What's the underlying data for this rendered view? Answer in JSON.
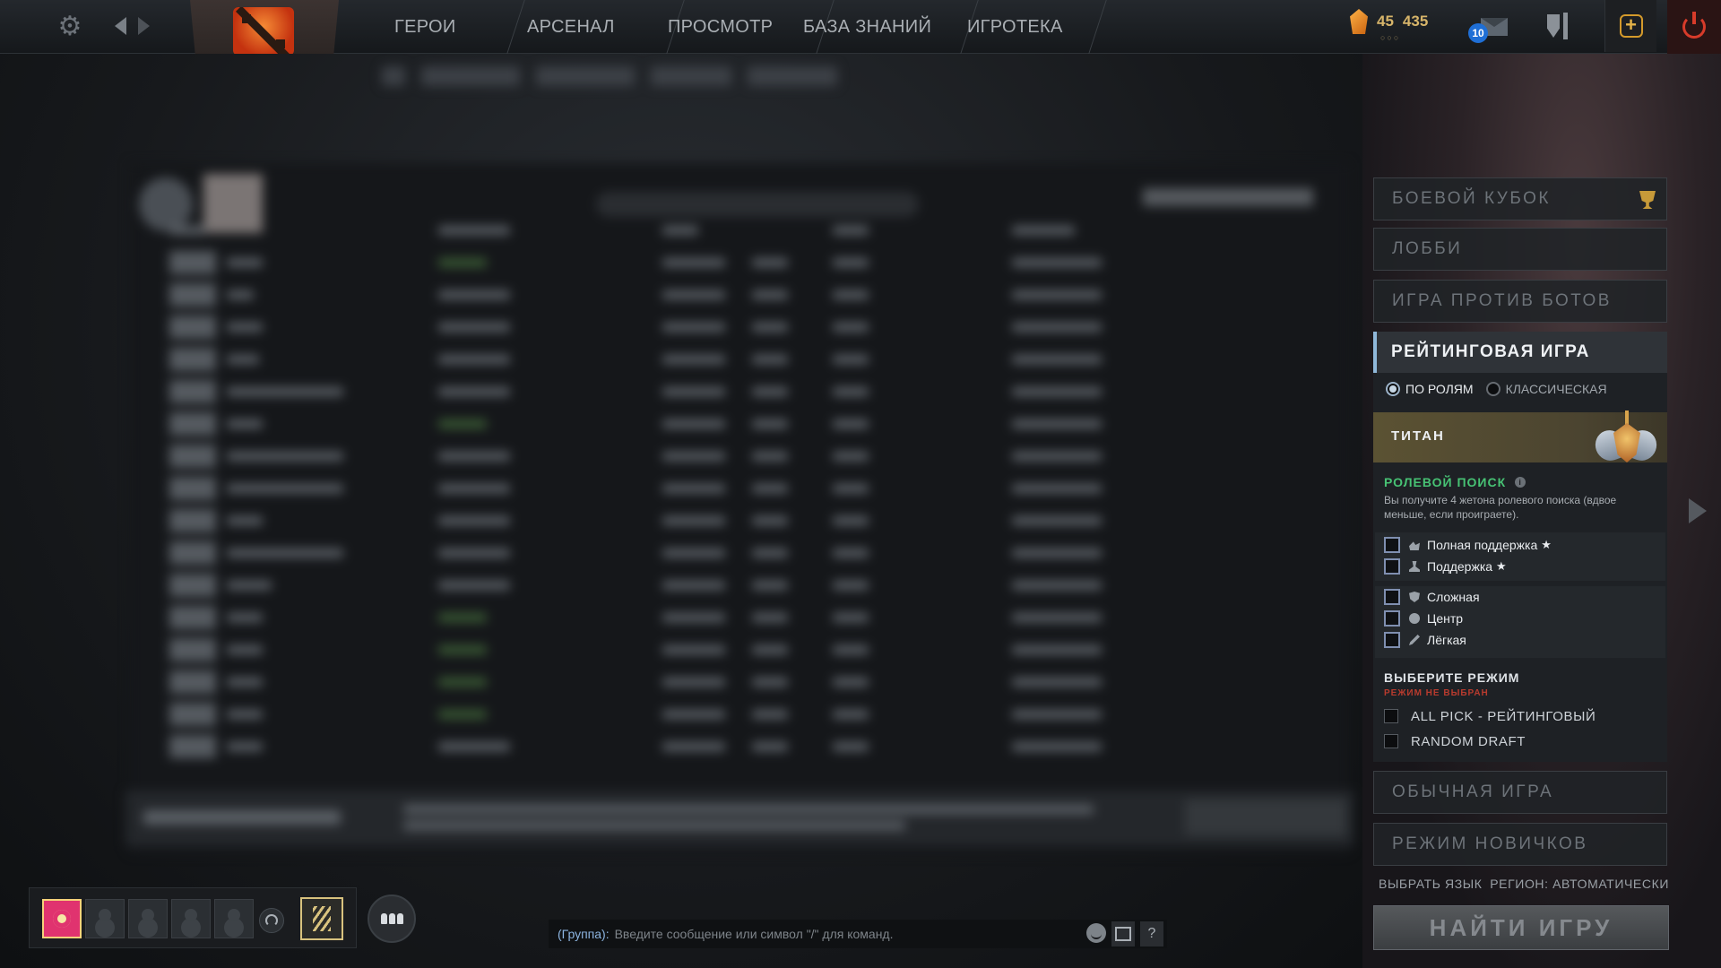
{
  "topbar": {
    "nav": [
      "ГЕРОИ",
      "АРСЕНАЛ",
      "ПРОСМОТР",
      "БАЗА ЗНАНИЙ",
      "ИГРОТЕКА"
    ],
    "currency_a": "45",
    "currency_b": "435",
    "currency_dots": "○○○",
    "mail_count": "10",
    "icons": {
      "settings": "gear-icon",
      "back": "back-arrow-icon",
      "forward": "forward-arrow-icon",
      "logo": "dota2-logo",
      "shards": "shard-icon",
      "mail": "mail-icon",
      "armory": "armory-icon",
      "plus": "plus-icon",
      "power": "power-icon"
    }
  },
  "play": {
    "battle_cup": "БОЕВОЙ КУБОК",
    "lobby": "ЛОББИ",
    "bots": "ИГРА ПРОТИВ БОТОВ",
    "ranked": {
      "title": "РЕЙТИНГОВАЯ ИГРА",
      "by_roles": "ПО РОЛЯМ",
      "classic": "КЛАССИЧЕСКАЯ",
      "selected_type": "ПО РОЛЯМ",
      "rank_name": "ТИТАН",
      "role_search": {
        "title": "РОЛЕВОЙ ПОИСК",
        "description": "Вы получите 4 жетона ролевого поиска (вдвое меньше, если проиграете)."
      },
      "roles": [
        {
          "label": "Полная поддержка",
          "starred": true,
          "checked": false,
          "icon": "hard-support-icon"
        },
        {
          "label": "Поддержка",
          "starred": true,
          "checked": false,
          "icon": "support-icon"
        },
        {
          "label": "Сложная",
          "starred": false,
          "checked": false,
          "icon": "offlane-icon"
        },
        {
          "label": "Центр",
          "starred": false,
          "checked": false,
          "icon": "mid-icon"
        },
        {
          "label": "Лёгкая",
          "starred": false,
          "checked": false,
          "icon": "safelane-icon"
        }
      ],
      "star_glyph": "★",
      "select_mode": {
        "title": "ВЫБЕРИТЕ РЕЖИМ",
        "warning": "РЕЖИМ НЕ ВЫБРАН",
        "options": [
          {
            "label": "ALL PICK - РЕЙТИНГОВЫЙ",
            "checked": false
          },
          {
            "label": "RANDOM DRAFT",
            "checked": false
          }
        ]
      }
    },
    "normal": "ОБЫЧНАЯ ИГРА",
    "newbie": "РЕЖИМ НОВИЧКОВ",
    "language": "ВЫБРАТЬ ЯЗЫК",
    "region": "РЕГИОН: АВТОМАТИЧЕСКИ",
    "find_game": "НАЙТИ ИГРУ"
  },
  "party": {
    "slots": 4
  },
  "chat": {
    "channel": "(Группа):",
    "placeholder": "Введите сообщение или символ \"/\" для команд.",
    "help": "?"
  },
  "colors": {
    "accent_ranked": "#8fb8d9",
    "role_green": "#47c274",
    "warning_red": "#b83b2e",
    "mail_badge": "#1f6fd6",
    "power_red": "#d73b2a"
  }
}
